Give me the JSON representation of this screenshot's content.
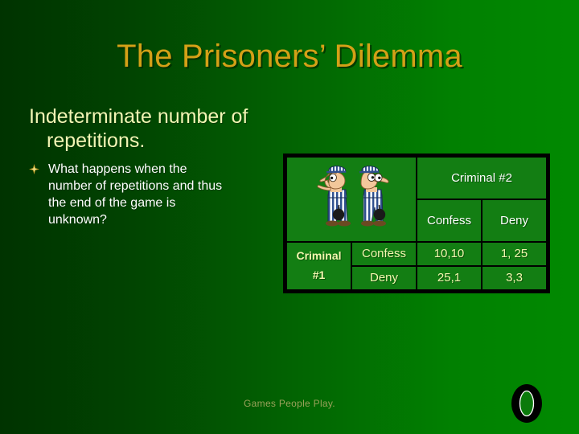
{
  "slide": {
    "title": "The Prisoners’ Dilemma",
    "background_left": "#003300",
    "background_right": "#018a01",
    "title_color": "#d4a017"
  },
  "body": {
    "bullet_level1_line1": "Indeterminate number of",
    "bullet_level1_line2": "repetitions.",
    "bullet_level2_marker": "star-bullet-icon",
    "bullet_level2_line1": "What happens when the",
    "bullet_level2_line2": "number of repetitions and thus",
    "bullet_level2_line3": "the end of the game is",
    "bullet_level2_line4": "unknown?",
    "level1_color": "#f2f5b4",
    "level2_color": "#ffffff"
  },
  "matrix": {
    "image_alt": "two-cartoon-prisoners-in-striped-uniforms",
    "col_player_label": "Criminal #2",
    "row_player_label_line1": "Criminal",
    "row_player_label_line2": "#1",
    "col_headers": [
      "Confess",
      "Deny"
    ],
    "row_headers": [
      "Confess",
      "Deny"
    ],
    "payoffs": [
      [
        "10,10",
        "1, 25"
      ],
      [
        "25,1",
        "3,3"
      ]
    ],
    "border_color": "#000000",
    "cell_color": "#137e13"
  },
  "footer": {
    "text": "Games People Play.",
    "logo": "letter-o-logo",
    "text_color": "#9aa15a"
  }
}
